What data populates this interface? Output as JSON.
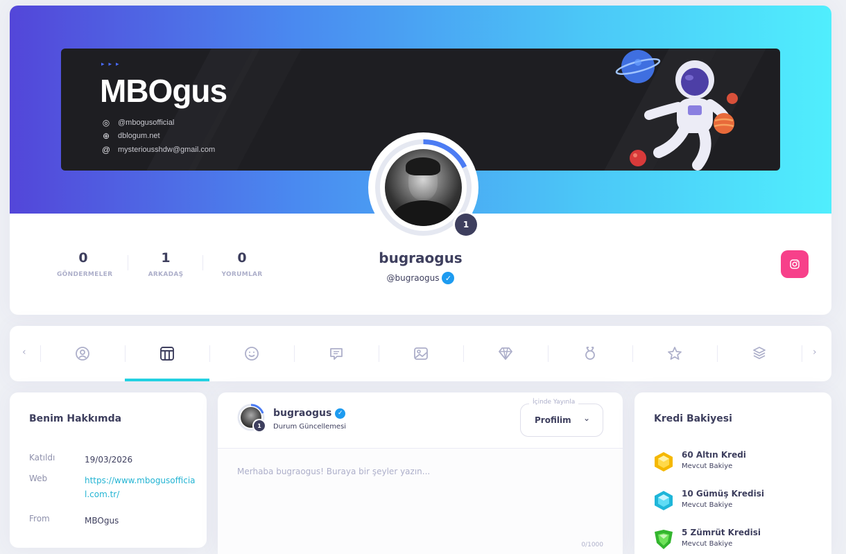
{
  "banner": {
    "brand": "MBOgus",
    "instagram": "@mbogusofficial",
    "website": "dblogum.net",
    "email": "mysteriousshdw@gmail.com"
  },
  "profile": {
    "level": "1",
    "username": "bugraogus",
    "handle": "@bugraogus",
    "stats": [
      {
        "value": "0",
        "label": "GÖNDERMELER"
      },
      {
        "value": "1",
        "label": "ARKADAŞ"
      },
      {
        "value": "0",
        "label": "YORUMLAR"
      }
    ]
  },
  "tabs": [
    {
      "icon": "profile-circle-icon"
    },
    {
      "icon": "timeline-icon",
      "active": true
    },
    {
      "icon": "smiley-icon"
    },
    {
      "icon": "forum-icon"
    },
    {
      "icon": "photos-icon"
    },
    {
      "icon": "diamond-icon"
    },
    {
      "icon": "badge-icon"
    },
    {
      "icon": "star-icon"
    },
    {
      "icon": "stack-icon"
    }
  ],
  "about": {
    "title": "Benim Hakkımda",
    "rows": [
      {
        "key": "Katıldı",
        "value": "19/03/2026"
      },
      {
        "key": "Web",
        "value": "https://www.mbogusofficial.com.tr/"
      },
      {
        "key": "From",
        "value": "MBOgus"
      }
    ]
  },
  "post": {
    "author": "bugraogus",
    "subtitle": "Durum Güncellemesi",
    "level": "1",
    "publish_label": "İçinde Yayınla",
    "publish_value": "Profilim",
    "placeholder": "Merhaba bugraogus! Buraya bir şeyler yazın...",
    "char_count": "0/1000"
  },
  "credits": {
    "title": "Kredi Bakiyesi",
    "items": [
      {
        "title": "60 Altın Kredi",
        "subtitle": "Mevcut Bakiye",
        "color": "#f5b800"
      },
      {
        "title": "10 Gümüş Kredisi",
        "subtitle": "Mevcut Bakiye",
        "color": "#2fc7e8"
      },
      {
        "title": "5 Zümrüt Kredisi",
        "subtitle": "Mevcut Bakiye",
        "color": "#3fcf3a"
      }
    ]
  },
  "colors": {
    "accent": "#23d2e2",
    "instagram": "#f7408a",
    "verified": "#1d9bf0"
  }
}
